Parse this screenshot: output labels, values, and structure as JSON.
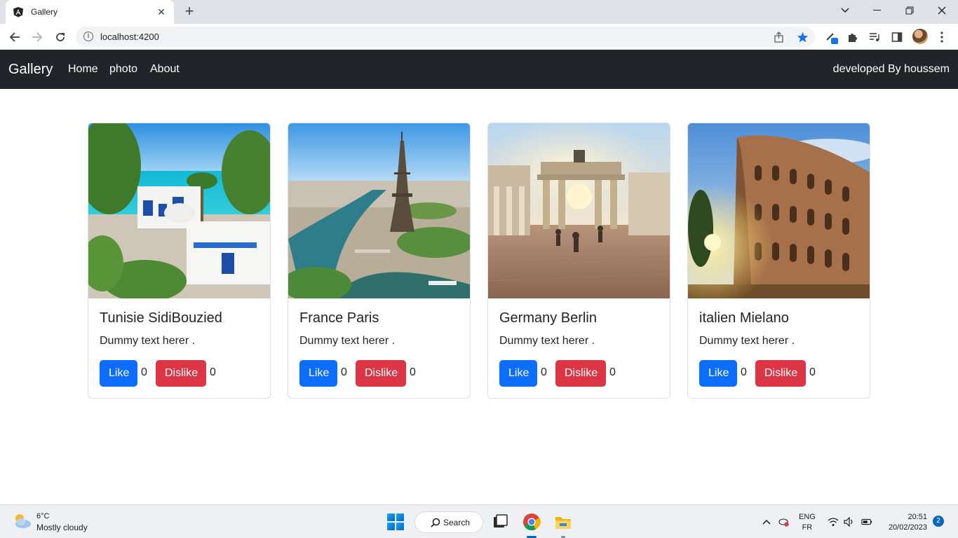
{
  "browser": {
    "tab_title": "Gallery",
    "tab_close": "✕",
    "new_tab": "+",
    "url": "localhost:4200",
    "accent": "#1a73e8"
  },
  "navbar": {
    "brand": "Gallery",
    "links": [
      "Home",
      "photo",
      "About"
    ],
    "right_text": "developed By houssem",
    "bg": "#212529"
  },
  "cards": [
    {
      "title": "Tunisie SidiBouzied",
      "text": "Dummy text herer .",
      "like_label": "Like",
      "dislike_label": "Dislike",
      "likes": "0",
      "dislikes": "0"
    },
    {
      "title": "France Paris",
      "text": "Dummy text herer .",
      "like_label": "Like",
      "dislike_label": "Dislike",
      "likes": "0",
      "dislikes": "0"
    },
    {
      "title": "Germany Berlin",
      "text": "Dummy text herer .",
      "like_label": "Like",
      "dislike_label": "Dislike",
      "likes": "0",
      "dislikes": "0"
    },
    {
      "title": "italien Mielano",
      "text": "Dummy text herer .",
      "like_label": "Like",
      "dislike_label": "Dislike",
      "likes": "0",
      "dislikes": "0"
    }
  ],
  "colors": {
    "like": "#0d6efd",
    "dislike": "#dc3545"
  },
  "taskbar": {
    "temperature": "6°C",
    "condition": "Mostly cloudy",
    "search_label": "Search",
    "lang_top": "ENG",
    "lang_bottom": "FR",
    "time": "20:51",
    "date": "20/02/2023",
    "notifications": "2"
  }
}
